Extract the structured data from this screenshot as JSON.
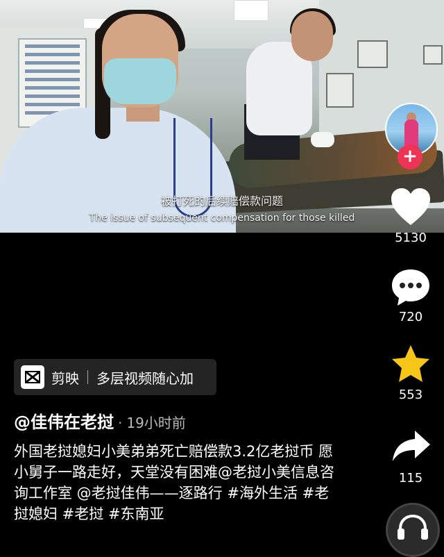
{
  "video": {
    "subtitle_cn": "被打死的后续赔偿款问题",
    "subtitle_en": "The issue of subsequent compensation for those killed"
  },
  "side_actions": {
    "like_count": "5130",
    "comment_count": "720",
    "favorite_count": "553",
    "share_count": "115",
    "follow_symbol": "+"
  },
  "app_badge": {
    "app_name": "剪映",
    "slogan": "多层视频随心加"
  },
  "post": {
    "author": "@佳伟在老挝",
    "separator": "·",
    "time": "19小时前",
    "caption": "外国老挝媳妇小美弟弟死亡赔偿款3.2亿老挝币 愿小舅子一路走好，天堂没有困难@老挝小美信息咨询工作室 @老挝佳伟——逐路行 #海外生活 #老挝媳妇 #老挝 #东南亚"
  },
  "colors": {
    "background": "#000000",
    "follow": "#ee3355",
    "star": "#f5c518",
    "text": "#ffffff"
  },
  "icons": [
    "heart-icon",
    "comment-icon",
    "star-icon",
    "share-icon",
    "capcut-icon",
    "headphones-icon"
  ]
}
